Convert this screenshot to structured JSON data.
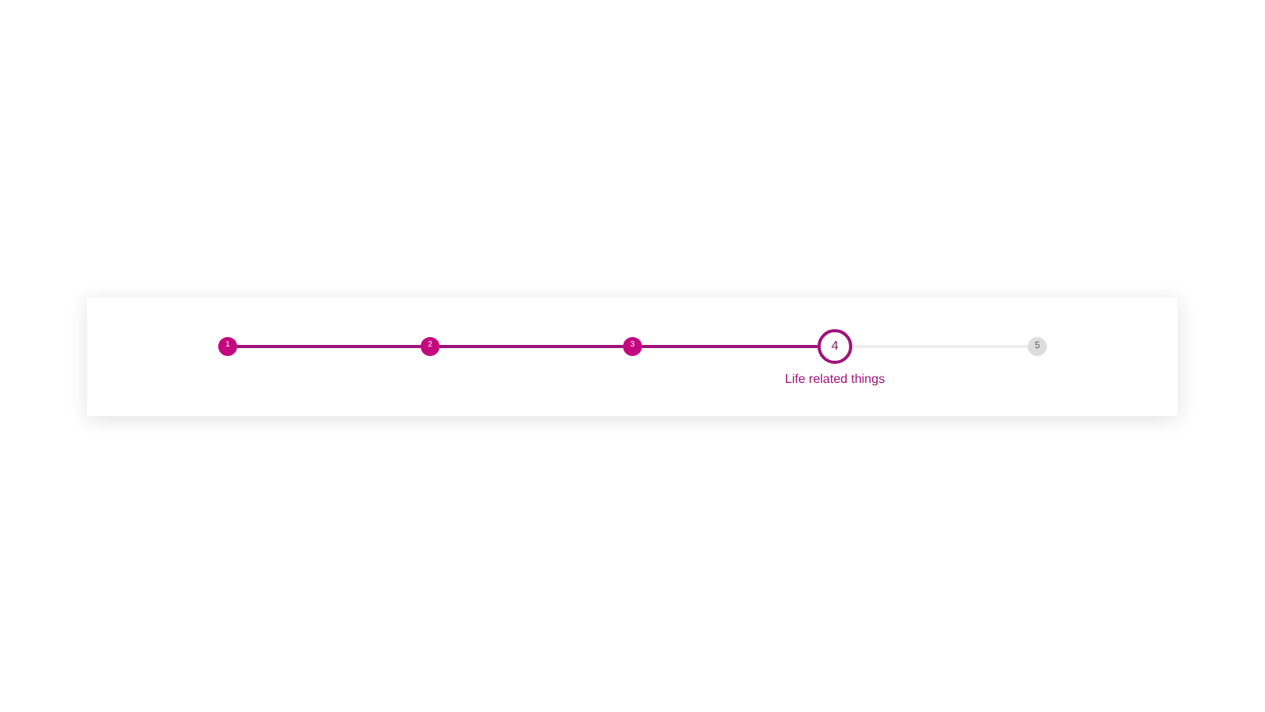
{
  "steps": [
    {
      "number": "1",
      "kind": "complete"
    },
    {
      "number": "2",
      "kind": "complete"
    },
    {
      "number": "3",
      "kind": "complete"
    },
    {
      "number": "4",
      "kind": "current",
      "caption": "Life related things"
    },
    {
      "number": "5",
      "kind": "upcoming"
    }
  ]
}
